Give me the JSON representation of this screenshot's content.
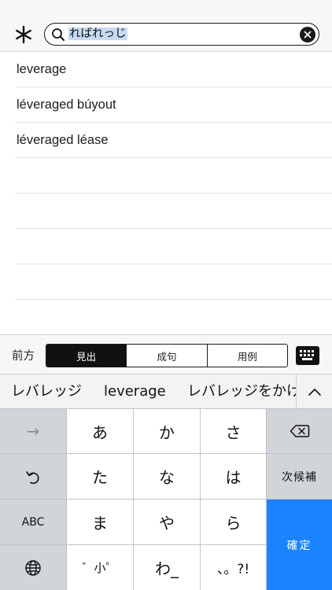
{
  "search": {
    "query": "ればれっじ"
  },
  "results": [
    {
      "label": "leverage"
    },
    {
      "label": "léveraged búyout"
    },
    {
      "label": "léveraged léase"
    },
    {
      "label": ""
    },
    {
      "label": ""
    },
    {
      "label": ""
    },
    {
      "label": ""
    },
    {
      "label": ""
    }
  ],
  "filter": {
    "label": "前方",
    "segments": [
      "見出",
      "成句",
      "用例"
    ],
    "active_index": 0
  },
  "candidates": [
    "レバレッジ",
    "leverage",
    "レバレッジをかけ"
  ],
  "keyboard": {
    "row1": [
      "→",
      "あ",
      "か",
      "さ",
      "⌫"
    ],
    "row2": [
      "↶",
      "た",
      "な",
      "は",
      "次候補"
    ],
    "row3": [
      "ABC",
      "ま",
      "や",
      "ら"
    ],
    "row4": [
      "globe",
      "゛小゜",
      "わ_",
      "、。?!"
    ],
    "confirm": "確定"
  },
  "colors": {
    "accent": "#1a84ff",
    "selection": "#c7dbf2"
  },
  "icons": {
    "star": "asterisk-icon",
    "search": "magnifier-icon",
    "clear": "close-icon",
    "keyboard": "keyboard-icon",
    "expand": "chevron-up-icon",
    "delete": "backspace-icon",
    "undo": "undo-icon",
    "globe": "globe-icon"
  }
}
